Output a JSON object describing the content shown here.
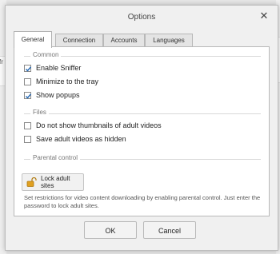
{
  "background": {
    "left_fragment": "fr"
  },
  "dialog": {
    "title": "Options",
    "close_label": "✕"
  },
  "tabs": [
    {
      "label": "General",
      "active": true
    },
    {
      "label": "Connection",
      "active": false
    },
    {
      "label": "Accounts",
      "active": false
    },
    {
      "label": "Languages",
      "active": false
    }
  ],
  "groups": {
    "common": "Common",
    "files": "Files",
    "parental": "Parental control"
  },
  "checkboxes": {
    "enable_sniffer": {
      "label": "Enable Sniffer",
      "checked": true
    },
    "minimize_tray": {
      "label": "Minimize to the tray",
      "checked": false
    },
    "show_popups": {
      "label": "Show popups",
      "checked": true
    },
    "no_thumbnails": {
      "label": "Do not show thumbnails of adult videos",
      "checked": false
    },
    "save_hidden": {
      "label": "Save adult videos as hidden",
      "checked": false
    }
  },
  "lock_button": {
    "label": "Lock adult sites"
  },
  "help_text": "Set restrictions for video content downloading by enabling parental control. Just enter the password to lock adult sites.",
  "footer": {
    "ok": "OK",
    "cancel": "Cancel"
  },
  "colors": {
    "check": "#2a6cb5",
    "lock": "#e0a020"
  }
}
